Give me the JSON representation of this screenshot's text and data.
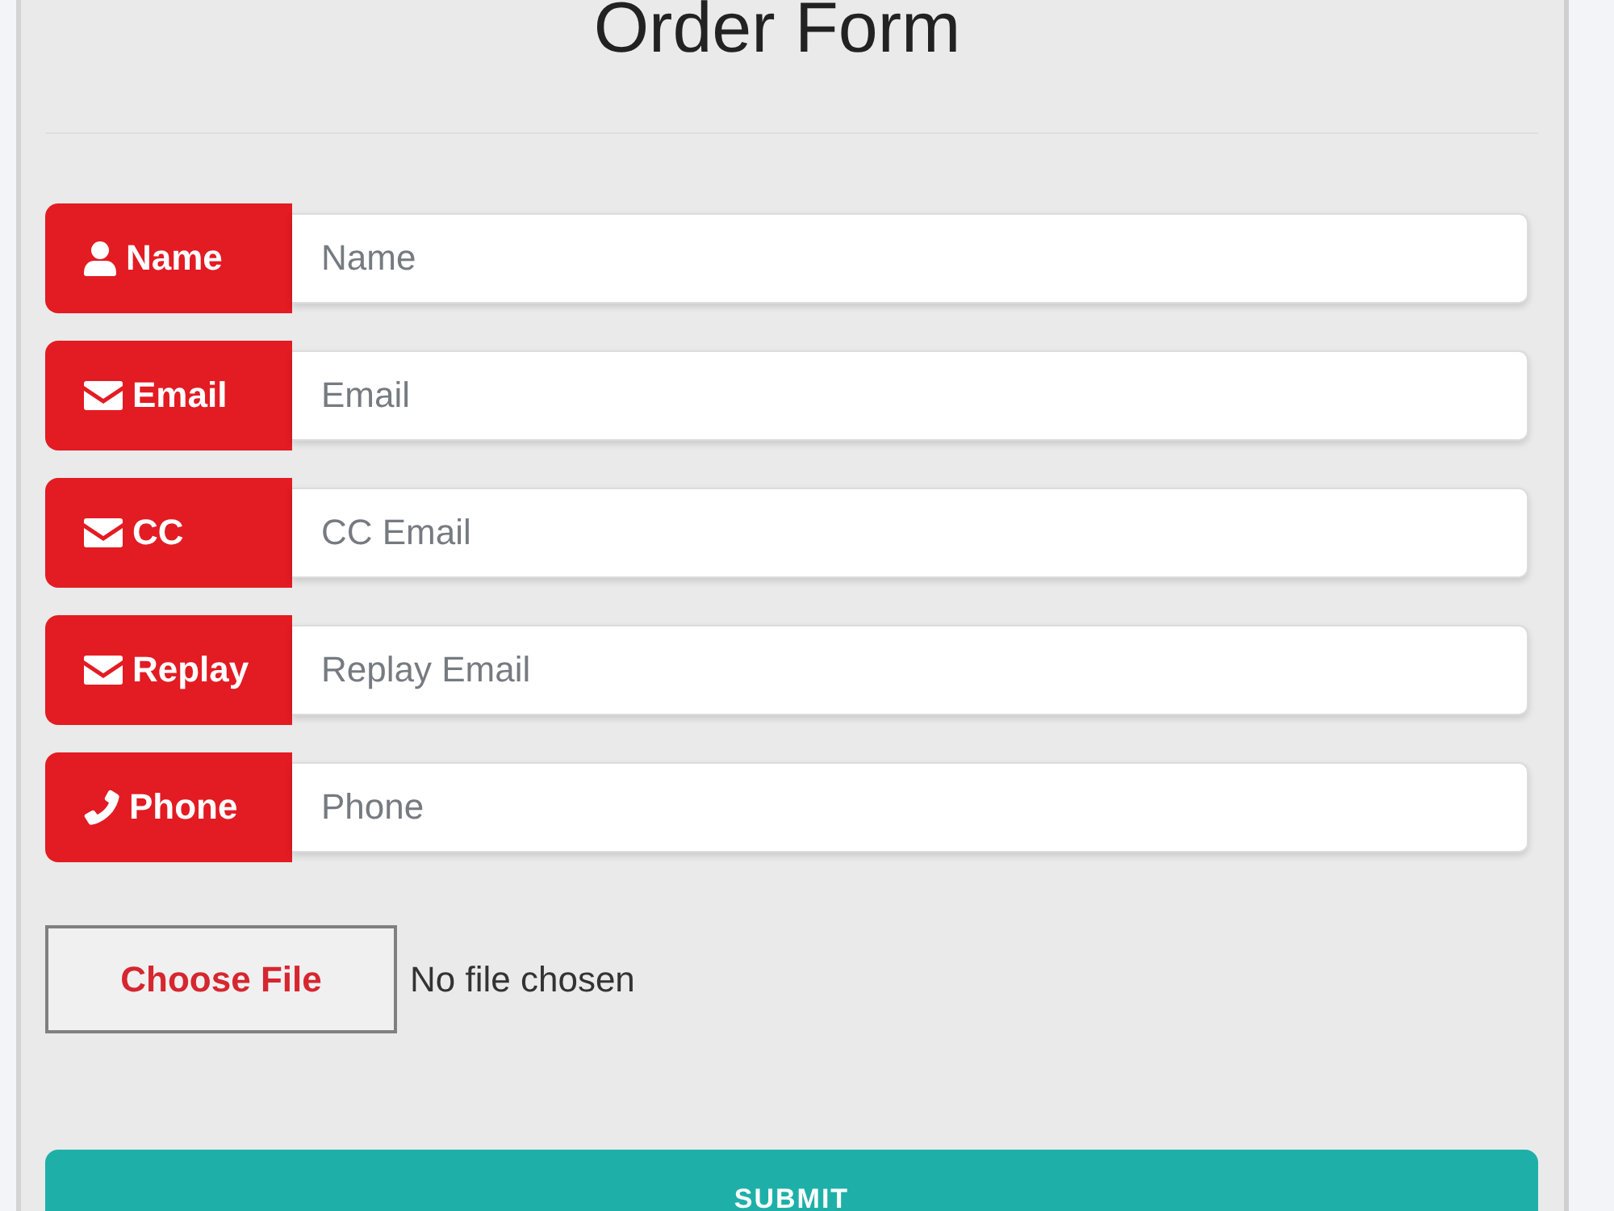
{
  "title": "Order Form",
  "fields": [
    {
      "kind": "text",
      "label": "Name",
      "placeholder": "Name"
    },
    {
      "kind": "email",
      "label": "Email",
      "placeholder": "Email"
    },
    {
      "kind": "email",
      "label": "CC",
      "placeholder": "CC Email"
    },
    {
      "kind": "email",
      "label": "Replay",
      "placeholder": "Replay Email"
    },
    {
      "kind": "phone",
      "label": "Phone",
      "placeholder": "Phone"
    }
  ],
  "file": {
    "button": "Choose File",
    "status": "No file chosen"
  },
  "submit": "SUBMIT"
}
